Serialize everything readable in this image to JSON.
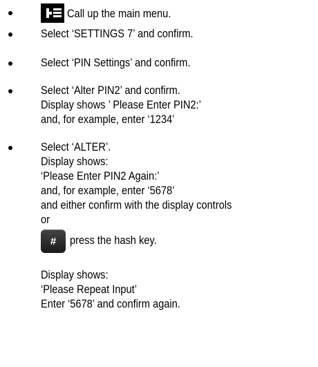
{
  "steps": [
    {
      "text": "Call up the main menu.",
      "icon": "menu-key-icon"
    },
    {
      "text": "Select ‘SETTINGS 7’ and confirm."
    },
    {
      "text": "Select ‘PIN Settings’ and confirm."
    },
    {
      "lines": [
        "Select ‘Alter PIN2’ and confirm.",
        "Display shows ’ Please Enter PIN2:’",
        "and, for example, enter ‘1234’"
      ]
    },
    {
      "lines": [
        "Select ‘ALTER’.",
        "Display shows:",
        "‘Please Enter PIN2 Again:’",
        "and, for example, enter ‘5678’",
        "and either confirm with the display controls",
        "or"
      ],
      "hash_key_label": "#",
      "hash_text": "press the hash key.",
      "after_lines": [
        "Display shows:",
        "‘Please Repeat Input’",
        "Enter ‘5678’ and confirm again."
      ]
    }
  ]
}
